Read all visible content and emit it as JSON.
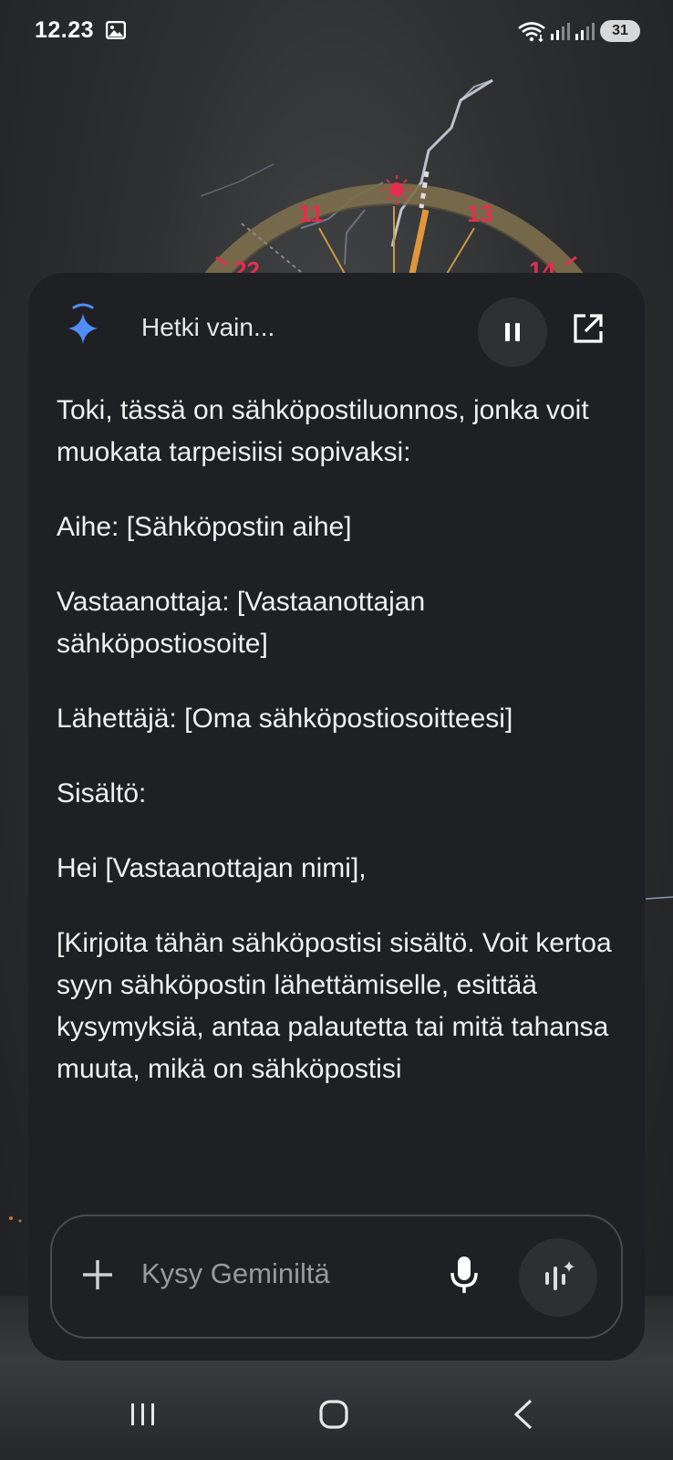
{
  "status_bar": {
    "time": "12.23",
    "battery": "31",
    "icons": [
      "gallery-icon",
      "wifi-icon",
      "signal-icon",
      "signal-icon"
    ]
  },
  "wallpaper": {
    "clock_numbers": [
      "11",
      "13",
      "22",
      "14"
    ],
    "accent_color": "#e0304e",
    "ring_color": "#9b8a5a"
  },
  "assistant": {
    "status_text": "Hetki vain...",
    "pause_icon": "pause-icon",
    "open_icon": "open-external-icon",
    "paragraphs": [
      "Toki, tässä on sähköpostiluonnos, jonka voit muokata tarpeisiisi sopivaksi:",
      "Aihe: [Sähköpostin aihe]",
      "Vastaanottaja: [Vastaanottajan sähköpostiosoite]",
      "Lähettäjä: [Oma sähköpostiosoitteesi]",
      "Sisältö:",
      "Hei [Vastaanottajan nimi],",
      "[Kirjoita tähän sähköpostisi sisältö. Voit kertoa syyn sähköpostin lähettämiselle, esittää kysymyksiä, antaa palautetta tai mitä tahansa muuta, mikä on sähköpostisi"
    ]
  },
  "input": {
    "placeholder": "Kysy Geminiltä",
    "value": ""
  },
  "colors": {
    "panel_bg": "#1f2023",
    "gemini_blue": "#4f8df5"
  }
}
